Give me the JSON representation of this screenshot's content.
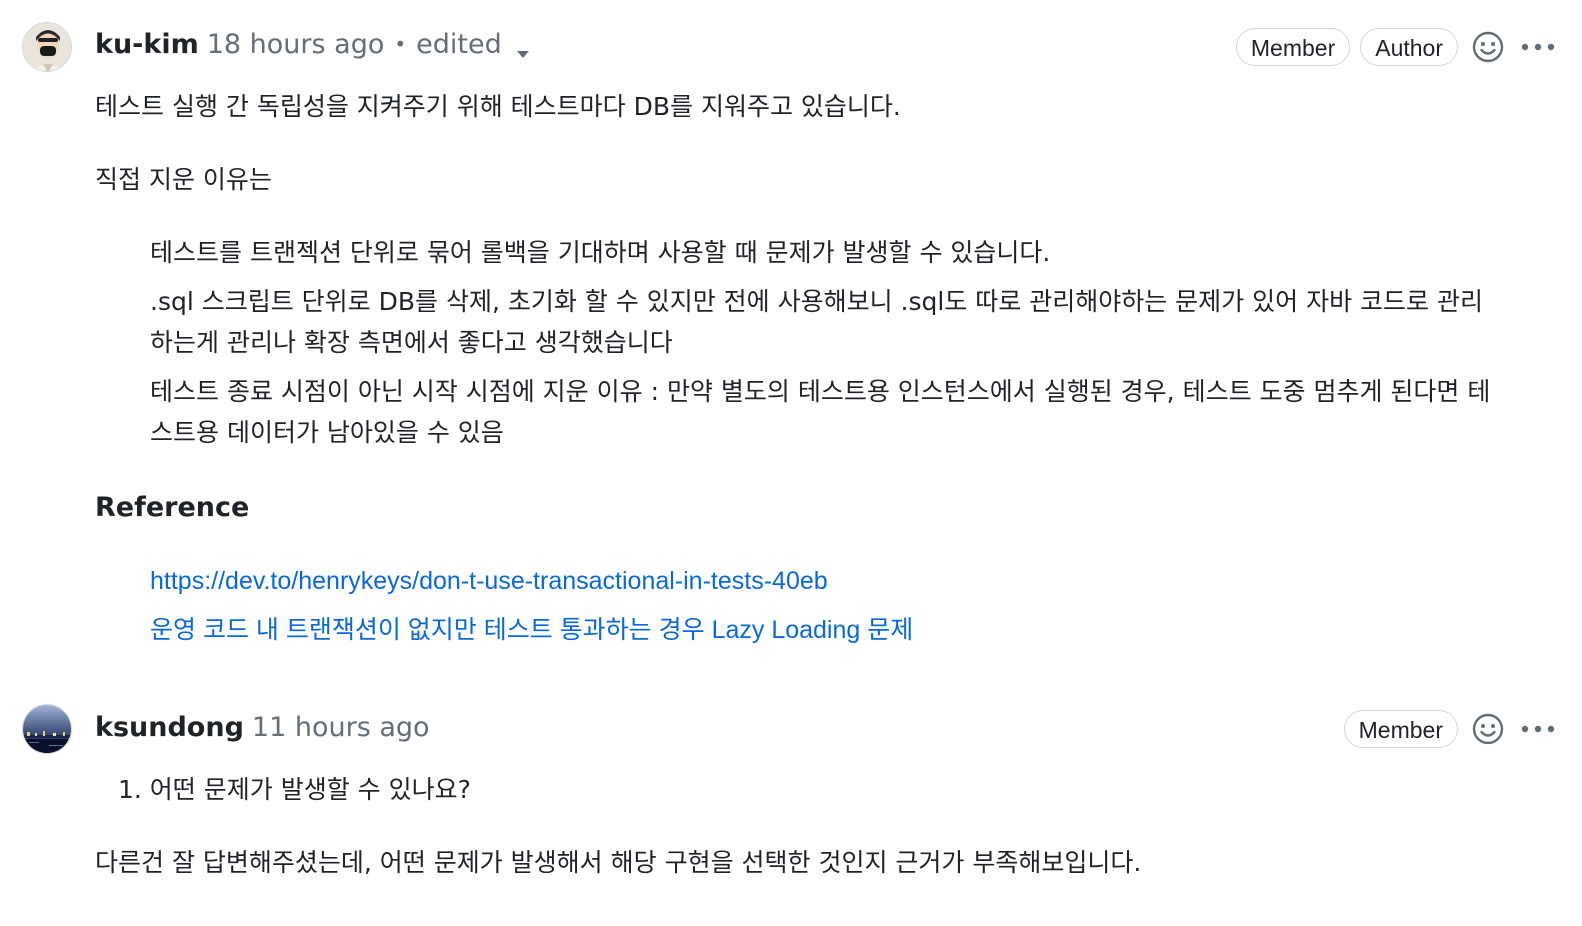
{
  "comments": [
    {
      "author": "ku-kim",
      "time": "18 hours ago",
      "separator": "•",
      "edited": "edited",
      "labels": [
        "Member",
        "Author"
      ],
      "body": {
        "p1": "테스트 실행 간 독립성을 지켜주기 위해 테스트마다 DB를 지워주고 있습니다.",
        "p2": "직접 지운 이유는",
        "list": [
          "테스트를 트랜젝션 단위로 묶어 롤백을 기대하며 사용할 때 문제가 발생할 수 있습니다.",
          ".sql 스크립트 단위로 DB를 삭제, 초기화 할 수 있지만 전에 사용해보니 .sql도 따로 관리해야하는 문제가 있어 자바 코드로 관리",
          "하는게 관리나 확장 측면에서 좋다고 생각했습니다",
          "테스트 종료 시점이 아닌 시작 시점에 지운 이유 : 만약 별도의 테스트용 인스턴스에서 실행된 경우, 테스트 도중 멈추게 된다면 테",
          "스트용 데이터가 남아있을 수 있음"
        ],
        "reference_heading": "Reference",
        "links": [
          "https://dev.to/henrykeys/don-t-use-transactional-in-tests-40eb",
          "운영 코드 내 트랜잭션이 없지만 테스트 통과하는 경우 Lazy Loading 문제"
        ]
      }
    },
    {
      "author": "ksundong",
      "time": "11 hours ago",
      "labels": [
        "Member"
      ],
      "body": {
        "ordered_item": "1. 어떤 문제가 발생할 수 있나요?",
        "p1": "다른건 잘 답변해주셨는데, 어떤 문제가 발생해서 해당 구현을 선택한 것인지 근거가 부족해보입니다."
      }
    }
  ],
  "icons": {
    "reaction": "smiley-icon",
    "more": "kebab-horizontal-icon",
    "edited_menu": "triangle-down-icon"
  },
  "colors": {
    "text": "#1f2328",
    "muted": "#656d76",
    "link": "#0969da",
    "border": "#d0d7de"
  }
}
